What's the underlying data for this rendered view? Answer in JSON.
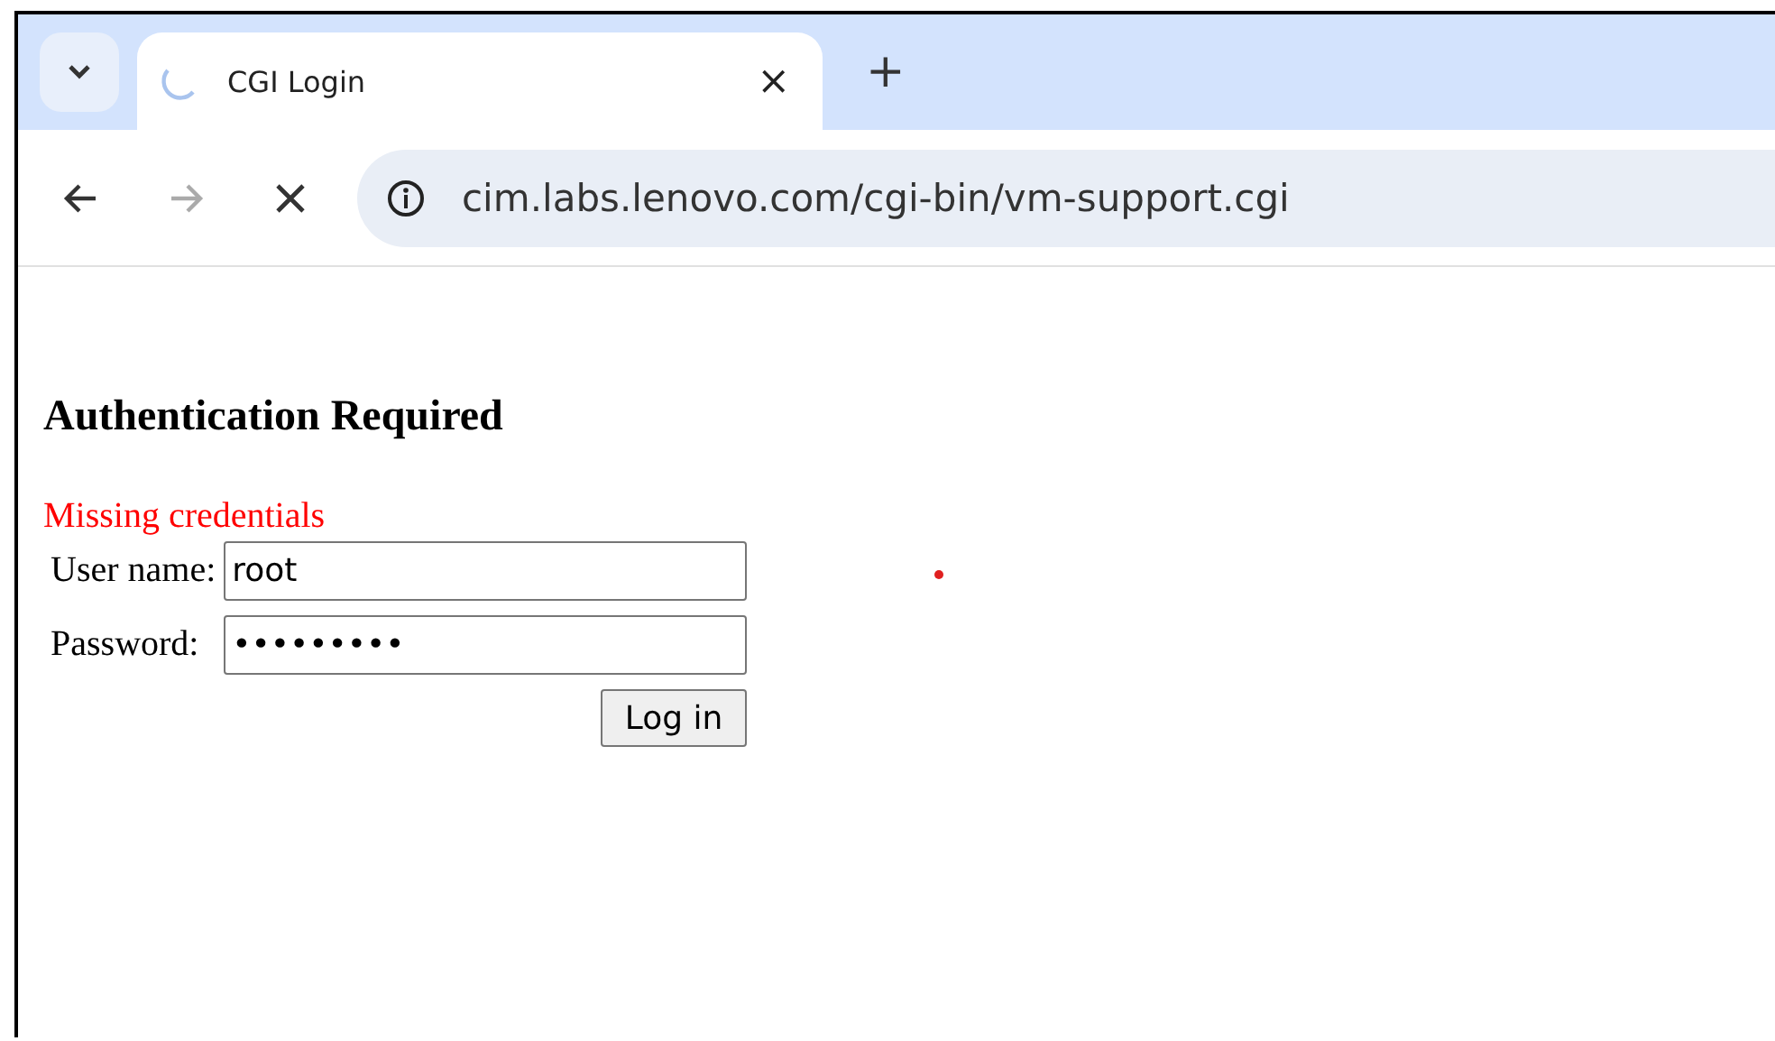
{
  "tab": {
    "title": "CGI Login",
    "loading": true
  },
  "tab_controls": {
    "close": "×",
    "new_tab": "+"
  },
  "toolbar": {
    "url": "cim.labs.lenovo.com/cgi-bin/vm-support.cgi",
    "loading": true
  },
  "page": {
    "heading": "Authentication Required",
    "error": "Missing credentials",
    "fields": [
      {
        "label": "User name:",
        "value": "root"
      },
      {
        "label": "Password:",
        "value": "•••••••••"
      }
    ],
    "submit": "Log in"
  }
}
